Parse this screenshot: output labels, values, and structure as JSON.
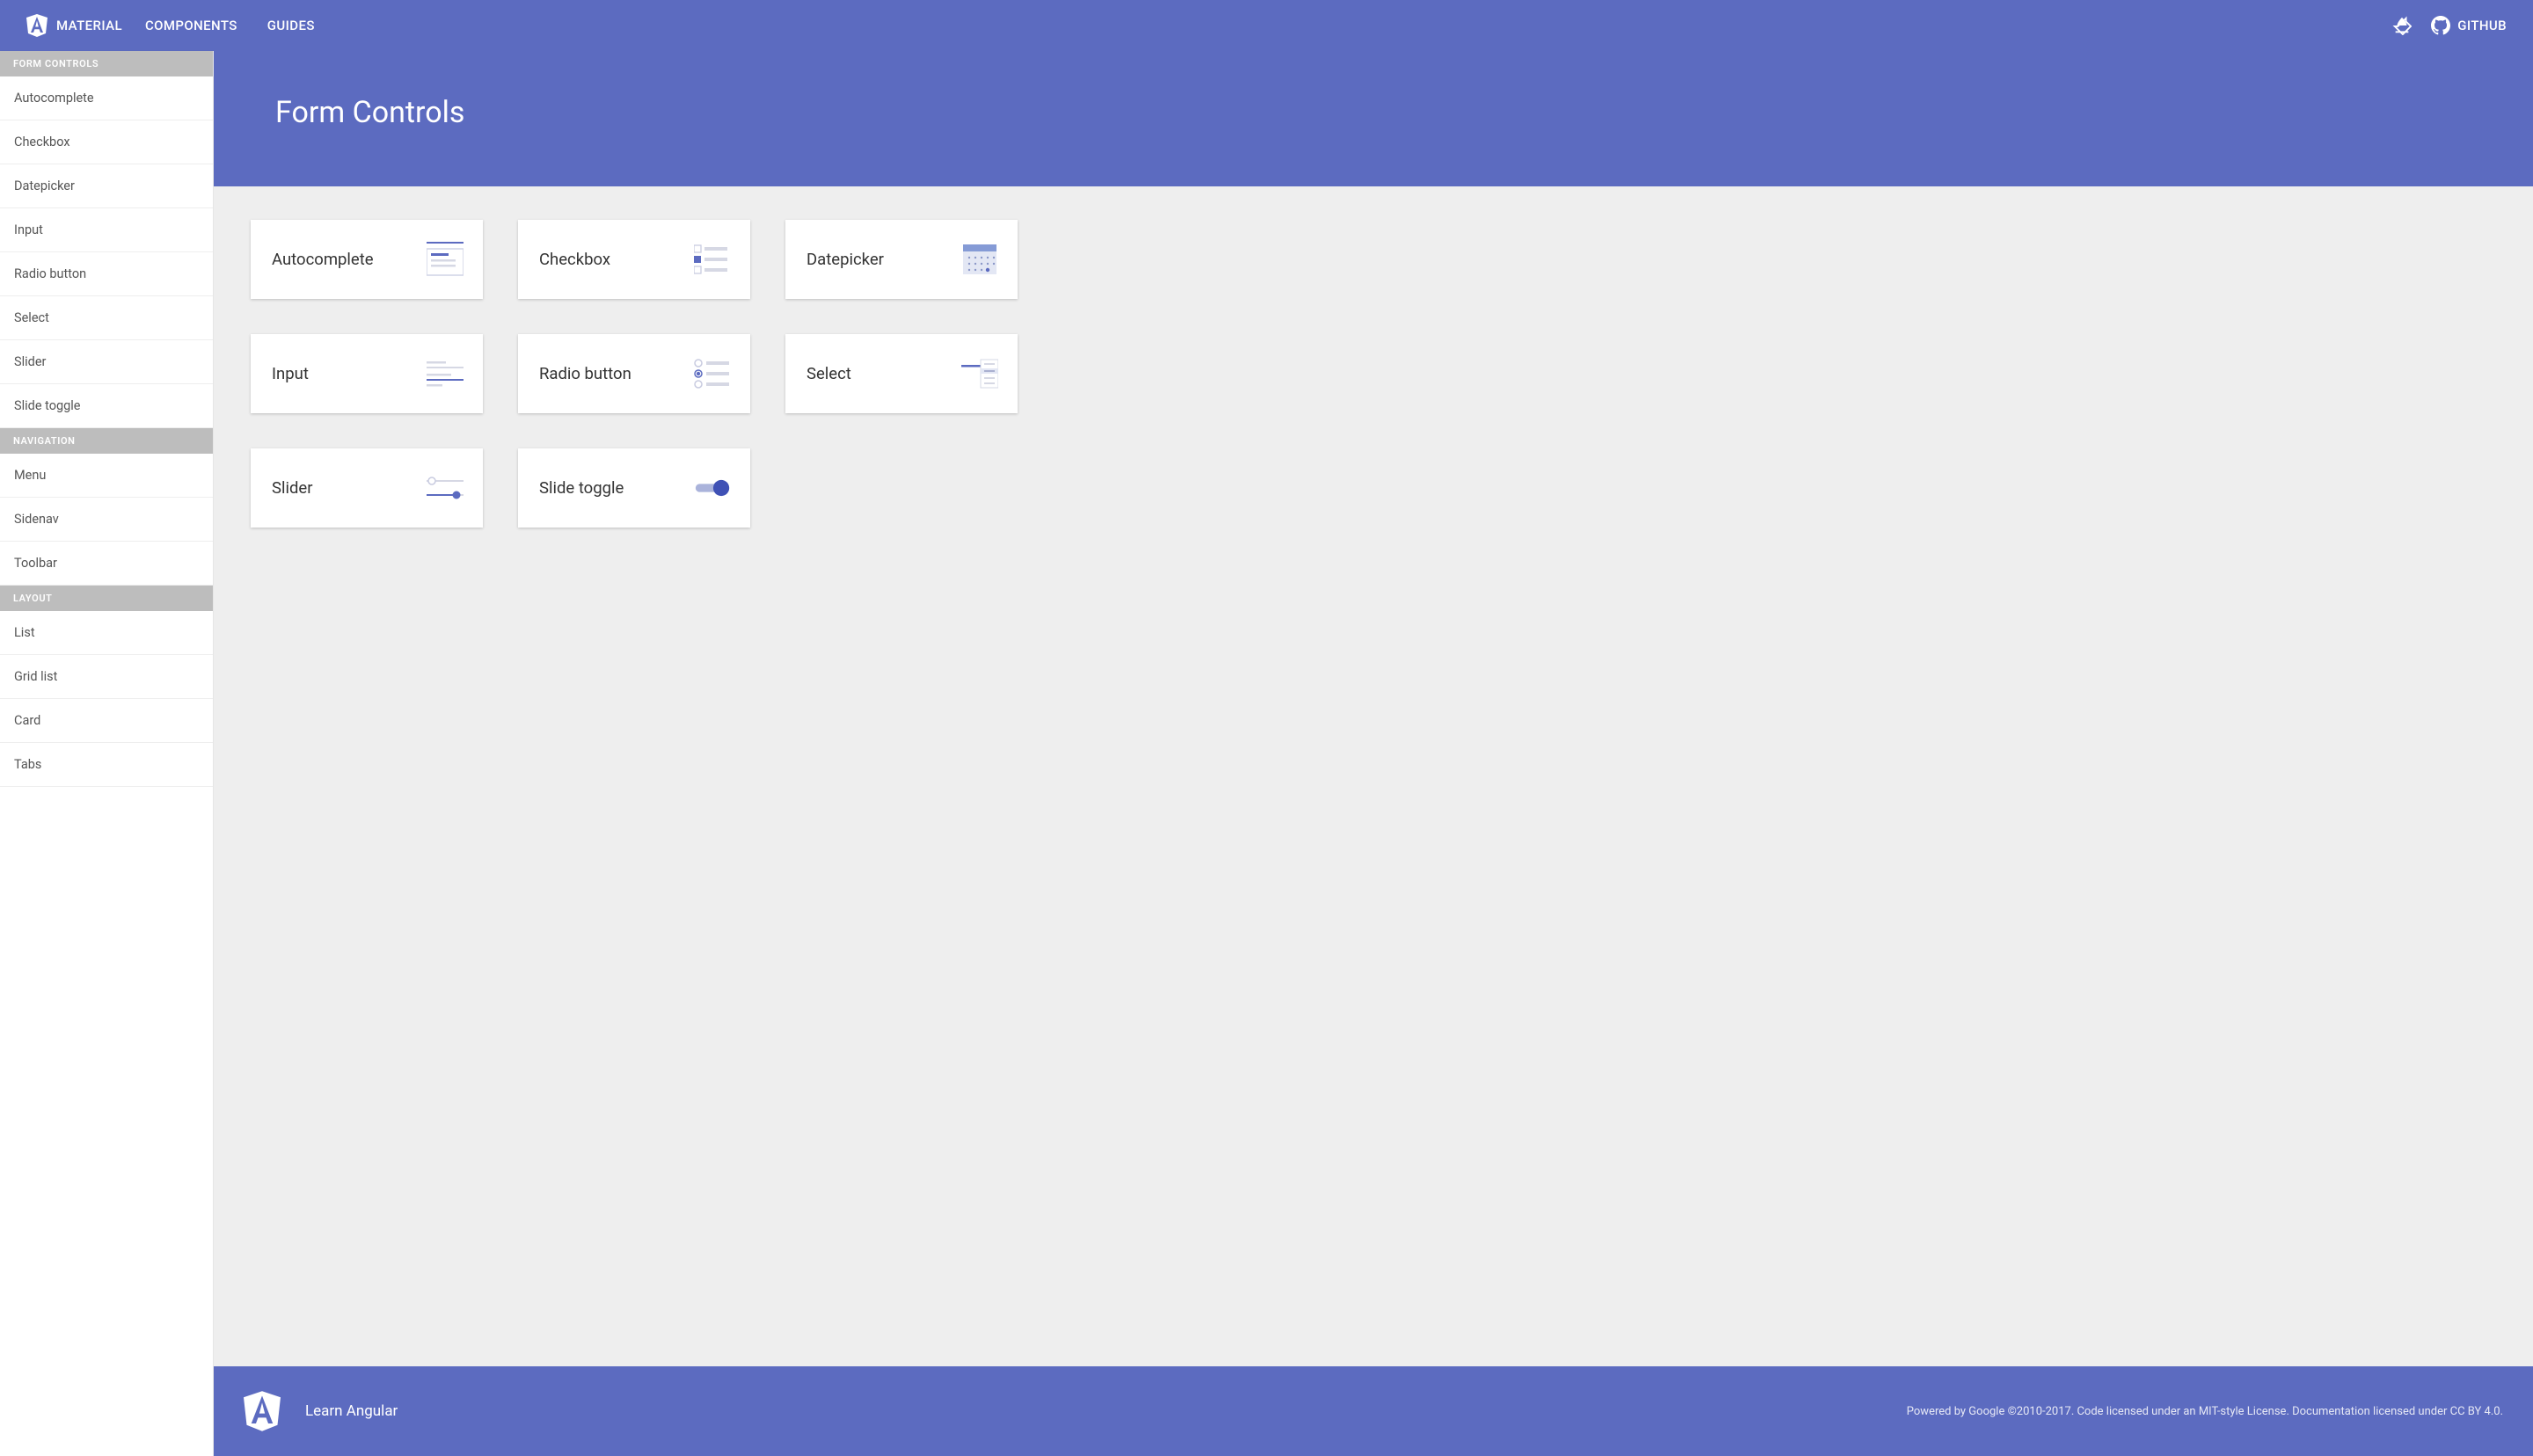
{
  "brand": {
    "name": "MATERIAL"
  },
  "nav": {
    "components": "COMPONENTS",
    "guides": "GUIDES",
    "github": "GITHUB"
  },
  "sidebar": {
    "sections": [
      {
        "header": "FORM CONTROLS",
        "items": [
          "Autocomplete",
          "Checkbox",
          "Datepicker",
          "Input",
          "Radio button",
          "Select",
          "Slider",
          "Slide toggle"
        ]
      },
      {
        "header": "NAVIGATION",
        "items": [
          "Menu",
          "Sidenav",
          "Toolbar"
        ]
      },
      {
        "header": "LAYOUT",
        "items": [
          "List",
          "Grid list",
          "Card",
          "Tabs"
        ]
      }
    ]
  },
  "page": {
    "title": "Form Controls",
    "cards": [
      {
        "label": "Autocomplete",
        "icon": "autocomplete-icon"
      },
      {
        "label": "Checkbox",
        "icon": "checkbox-icon"
      },
      {
        "label": "Datepicker",
        "icon": "datepicker-icon"
      },
      {
        "label": "Input",
        "icon": "input-icon"
      },
      {
        "label": "Radio button",
        "icon": "radio-icon"
      },
      {
        "label": "Select",
        "icon": "select-icon"
      },
      {
        "label": "Slider",
        "icon": "slider-icon"
      },
      {
        "label": "Slide toggle",
        "icon": "slide-toggle-icon"
      }
    ]
  },
  "footer": {
    "learn": "Learn Angular",
    "legal": "Powered by Google ©2010-2017. Code licensed under an MIT-style License. Documentation licensed under CC BY 4.0."
  }
}
